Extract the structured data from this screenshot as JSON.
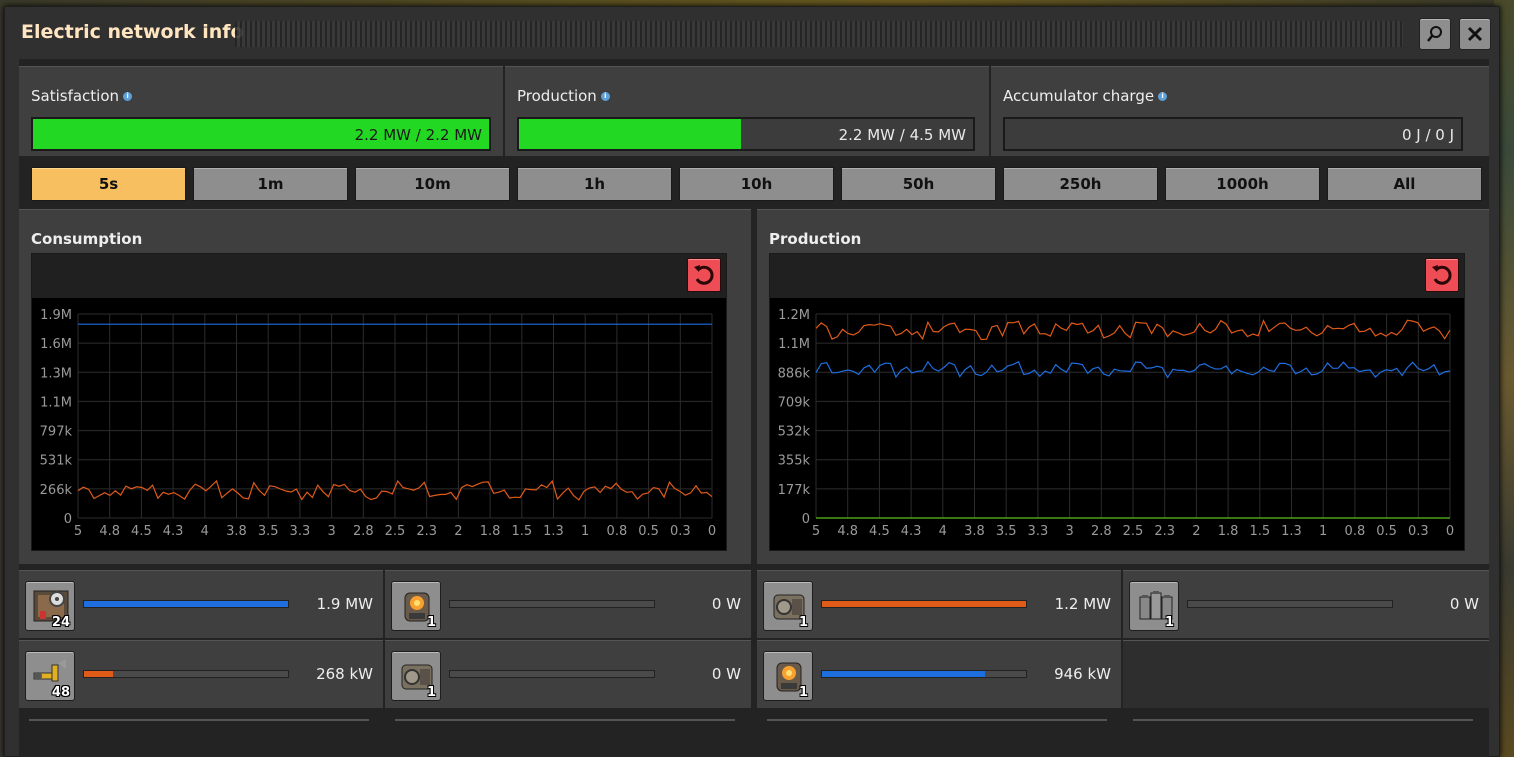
{
  "window": {
    "title": "Electric network info"
  },
  "titlebar": {
    "search_icon": "search-icon",
    "close_icon": "close-icon"
  },
  "stats": [
    {
      "label": "Satisfaction",
      "value": "2.2 MW / 2.2 MW",
      "fill": 1.0
    },
    {
      "label": "Production",
      "value": "2.2 MW / 4.5 MW",
      "fill": 0.49
    },
    {
      "label": "Accumulator charge",
      "value": "0 J / 0 J",
      "fill": 0
    }
  ],
  "tabs": [
    "5s",
    "1m",
    "10m",
    "1h",
    "10h",
    "50h",
    "250h",
    "1000h",
    "All"
  ],
  "active_tab": "5s",
  "colors": {
    "accent": "#f7bf60",
    "green": "#23d823",
    "blue": "#1e6ee0",
    "orange": "#e05a18",
    "reset": "#ef4d55"
  },
  "graphs": {
    "consumption": {
      "title": "Consumption",
      "yticks": [
        "1.9M",
        "1.6M",
        "1.3M",
        "1.1M",
        "797k",
        "531k",
        "266k",
        "0"
      ],
      "xticks": [
        "5",
        "4.8",
        "4.5",
        "4.3",
        "4",
        "3.8",
        "3.5",
        "3.3",
        "3",
        "2.8",
        "2.5",
        "2.3",
        "2",
        "1.8",
        "1.5",
        "1.3",
        "1",
        "0.8",
        "0.5",
        "0.3",
        "0"
      ]
    },
    "production": {
      "title": "Production",
      "yticks": [
        "1.2M",
        "1.1M",
        "886k",
        "709k",
        "532k",
        "355k",
        "177k",
        "0"
      ],
      "xticks": [
        "5",
        "4.8",
        "4.5",
        "4.3",
        "4",
        "3.8",
        "3.5",
        "3.3",
        "3",
        "2.8",
        "2.5",
        "2.3",
        "2",
        "1.8",
        "1.5",
        "1.3",
        "1",
        "0.8",
        "0.5",
        "0.3",
        "0"
      ]
    }
  },
  "chart_data": [
    {
      "type": "line",
      "title": "Consumption",
      "xlim": [
        5,
        0
      ],
      "ylim": [
        0,
        2000000
      ],
      "series": [
        {
          "color": "#1e6ee0",
          "y": [
            1900000.0,
            1900000.0
          ]
        },
        {
          "color": "#e05a18",
          "y": [
            268000
          ]
        }
      ]
    },
    {
      "type": "line",
      "title": "Production",
      "xlim": [
        5,
        0
      ],
      "ylim": [
        0,
        1300000
      ],
      "series": [
        {
          "color": "#e05a18",
          "y": [
            1200000.0
          ]
        },
        {
          "color": "#1e6ee0",
          "y": [
            946000
          ]
        },
        {
          "color": "#5ac018",
          "y": [
            0,
            0
          ]
        }
      ]
    }
  ],
  "consumers": [
    {
      "icon": "assembling-machine-icon",
      "count": "24",
      "value": "1.9 MW",
      "fill": 1.0,
      "color": "#1e6ee0"
    },
    {
      "icon": "boiler-icon",
      "count": "1",
      "value": "0 W",
      "fill": 0,
      "color": "#1e6ee0"
    },
    {
      "icon": "inserter-icon",
      "count": "48",
      "value": "268 kW",
      "fill": 0.14,
      "color": "#e05a18"
    },
    {
      "icon": "steam-engine-icon",
      "count": "1",
      "value": "0 W",
      "fill": 0,
      "color": "#1e6ee0"
    }
  ],
  "producers": [
    {
      "icon": "steam-engine-icon",
      "count": "1",
      "value": "1.2 MW",
      "fill": 1.0,
      "color": "#e05a18"
    },
    {
      "icon": "accumulator-icon",
      "count": "1",
      "value": "0 W",
      "fill": 0,
      "color": "#1e6ee0"
    },
    {
      "icon": "boiler-icon",
      "count": "1",
      "value": "946 kW",
      "fill": 0.8,
      "color": "#1e6ee0"
    }
  ]
}
